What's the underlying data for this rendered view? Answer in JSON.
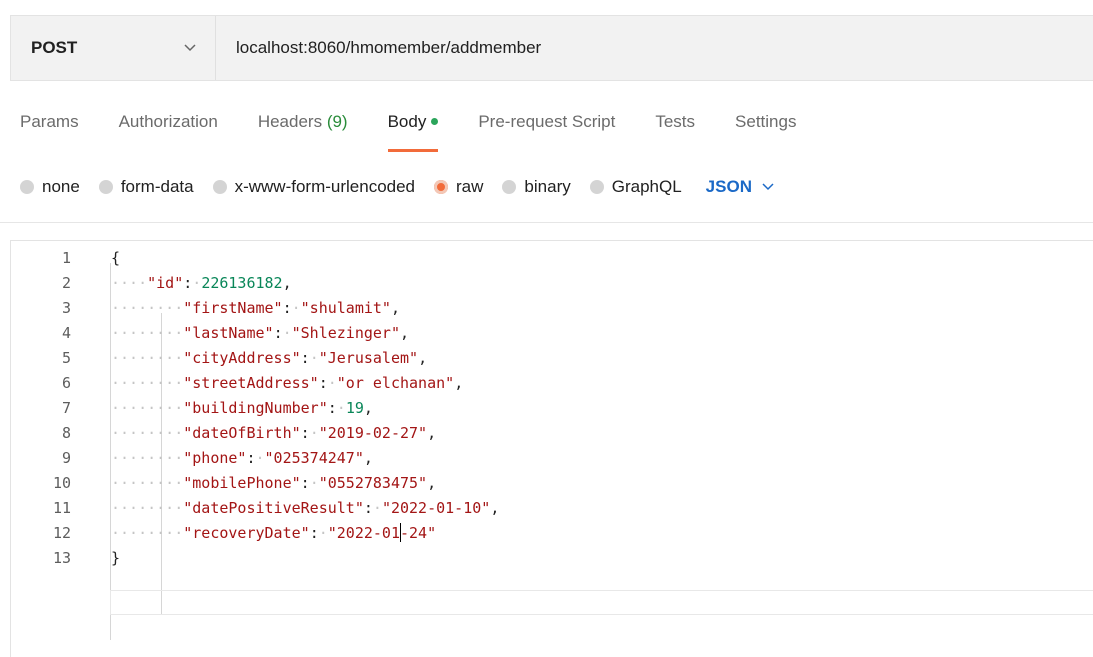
{
  "request": {
    "method": "POST",
    "url": "localhost:8060/hmomember/addmember"
  },
  "tabs": [
    {
      "label": "Params"
    },
    {
      "label": "Authorization"
    },
    {
      "label": "Headers",
      "count": "(9)"
    },
    {
      "label": "Body"
    },
    {
      "label": "Pre-request Script"
    },
    {
      "label": "Tests"
    },
    {
      "label": "Settings"
    }
  ],
  "active_tab": "Body",
  "body_types": [
    {
      "label": "none"
    },
    {
      "label": "form-data"
    },
    {
      "label": "x-www-form-urlencoded"
    },
    {
      "label": "raw",
      "selected": true
    },
    {
      "label": "binary"
    },
    {
      "label": "GraphQL"
    }
  ],
  "format": "JSON",
  "colors": {
    "accent": "#f26b3a",
    "format_link": "#1b69c7",
    "body_dot": "#2ba55b",
    "json_key": "#a31515",
    "json_number": "#098658"
  },
  "editor": {
    "lines": [
      {
        "n": "1",
        "text": "{"
      },
      {
        "n": "2",
        "text": "\"id\": 226136182,"
      },
      {
        "n": "3",
        "text": "\"firstName\": \"shulamit\","
      },
      {
        "n": "4",
        "text": "\"lastName\": \"Shlezinger\","
      },
      {
        "n": "5",
        "text": "\"cityAddress\": \"Jerusalem\","
      },
      {
        "n": "6",
        "text": "\"streetAddress\": \"or elchanan\","
      },
      {
        "n": "7",
        "text": "\"buildingNumber\": 19,"
      },
      {
        "n": "8",
        "text": "\"dateOfBirth\": \"2019-02-27\","
      },
      {
        "n": "9",
        "text": "\"phone\": \"025374247\","
      },
      {
        "n": "10",
        "text": "\"mobilePhone\": \"0552783475\","
      },
      {
        "n": "11",
        "text": "\"datePositiveResult\": \"2022-01-10\","
      },
      {
        "n": "12",
        "text": "\"recoveryDate\": \"2022-01-24\""
      },
      {
        "n": "13",
        "text": "}"
      }
    ]
  }
}
